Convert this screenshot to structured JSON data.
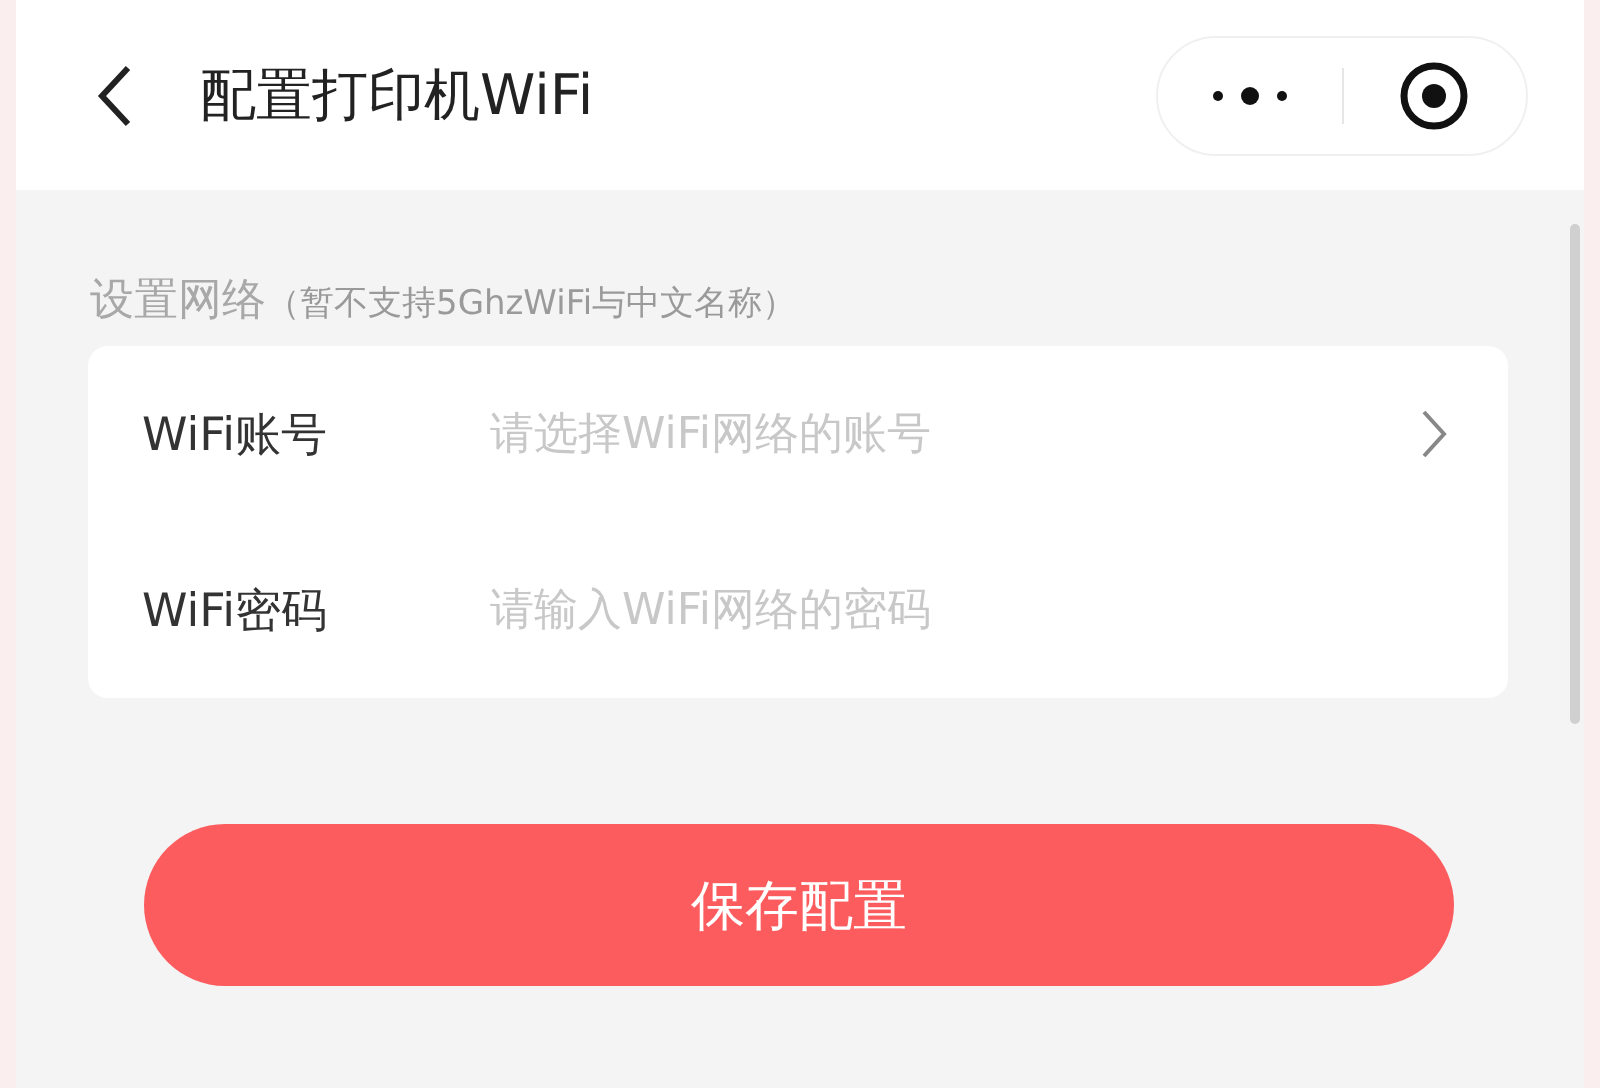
{
  "header": {
    "title": "配置打印机WiFi"
  },
  "section": {
    "title": "设置网络",
    "note": "（暂不支持5GhzWiFi与中文名称）"
  },
  "fields": [
    {
      "kind": "select",
      "label": "WiFi账号",
      "placeholder": "请选择WiFi网络的账号"
    },
    {
      "kind": "input",
      "label": "WiFi密码",
      "placeholder": "请输入WiFi网络的密码"
    }
  ],
  "buttons": [
    "保存配置"
  ]
}
